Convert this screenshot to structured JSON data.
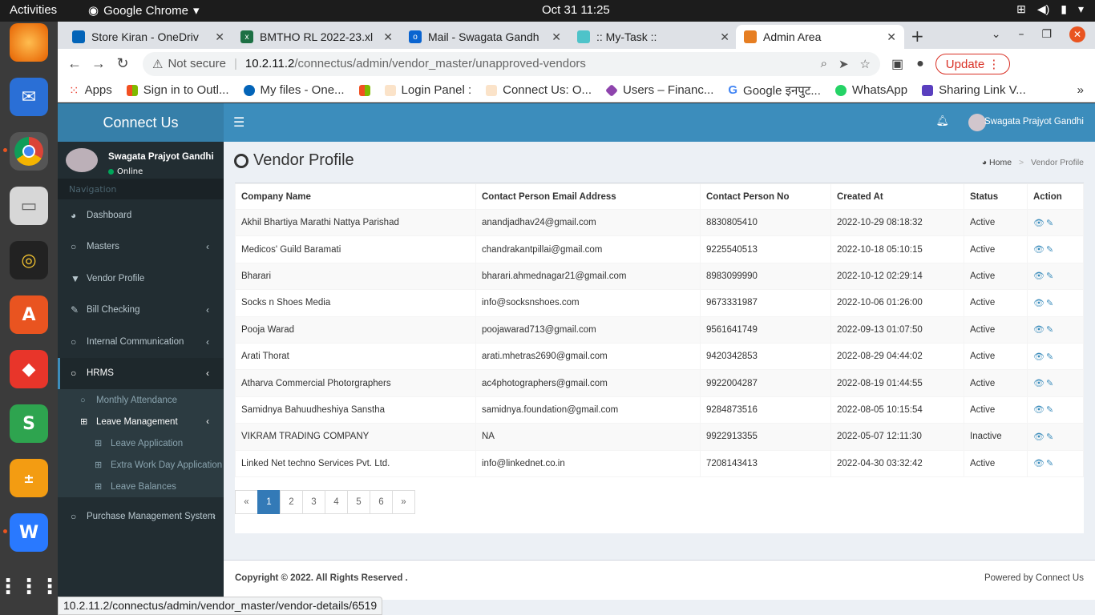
{
  "topbar": {
    "activities": "Activities",
    "app_name": "Google Chrome",
    "clock": "Oct 31  11:25"
  },
  "tabs": [
    {
      "title": "Store Kiran - OneDriv",
      "color": "#0364b8"
    },
    {
      "title": "BMTHO RL 2022-23.xl",
      "color": "#1d7044"
    },
    {
      "title": "Mail - Swagata Gandh",
      "color": "#0a64d0"
    },
    {
      "title": ":: My-Task ::",
      "color": "#4ec3c9"
    },
    {
      "title": "Admin Area",
      "color": "#e67e22"
    }
  ],
  "omnibox": {
    "security": "Not secure",
    "host": "10.2.11.2",
    "path": "/connectus/admin/vendor_master/unapproved-vendors"
  },
  "update_label": "Update",
  "bookmarks": [
    {
      "label": "Apps",
      "color": "#ea4335"
    },
    {
      "label": "Sign in to Outl...",
      "color": "#f25022"
    },
    {
      "label": "My files - One...",
      "color": "#0364b8"
    },
    {
      "label": "",
      "color": "#7fba00"
    },
    {
      "label": "Login Panel :",
      "color": "#e67e22"
    },
    {
      "label": "Connect Us: O...",
      "color": "#e67e22"
    },
    {
      "label": "Users – Financ...",
      "color": "#8e44ad"
    },
    {
      "label": "Google इनपुट...",
      "color": "#4285f4"
    },
    {
      "label": "WhatsApp",
      "color": "#25d366"
    },
    {
      "label": "Sharing Link V...",
      "color": "#5a3fbf"
    }
  ],
  "sidebar": {
    "logo": "Connect Us",
    "user_name": "Swagata Prajyot Gandhi",
    "user_status": "Online",
    "nav_header": "Navigation",
    "items": [
      {
        "label": "Dashboard",
        "icon": "dashboard-icon",
        "glyph": "◕"
      },
      {
        "label": "Masters",
        "icon": "circle-icon",
        "glyph": "○",
        "chev": "‹"
      },
      {
        "label": "Vendor Profile",
        "icon": "filter-icon",
        "glyph": "▼"
      },
      {
        "label": "Bill Checking",
        "icon": "pencil-icon",
        "glyph": "✎",
        "chev": "‹"
      },
      {
        "label": "Internal Communication",
        "icon": "circle-icon",
        "glyph": "○",
        "chev": "‹"
      },
      {
        "label": "HRMS",
        "icon": "circle-icon",
        "glyph": "○",
        "chev": "‹"
      }
    ],
    "hrms_sub": {
      "monthly": "Monthly Attendance",
      "leave_mgmt": "Leave Management",
      "leave_items": [
        "Leave Application",
        "Extra Work Day Application",
        "Leave Balances"
      ]
    },
    "purchase": "Purchase Management System"
  },
  "header": {
    "user_name": "Swagata Prajyot Gandhi"
  },
  "content": {
    "title": "Vendor Profile",
    "crumb_home": "Home",
    "crumb_current": "Vendor Profile"
  },
  "table": {
    "columns": [
      "Company Name",
      "Contact Person Email Address",
      "Contact Person No",
      "Created At",
      "Status",
      "Action"
    ],
    "rows": [
      [
        "Akhil Bhartiya Marathi Nattya Parishad",
        "anandjadhav24@gmail.com",
        "8830805410",
        "2022-10-29 08:18:32",
        "Active"
      ],
      [
        "Medicos' Guild Baramati",
        "chandrakantpillai@gmail.com",
        "9225540513",
        "2022-10-18 05:10:15",
        "Active"
      ],
      [
        "Bharari",
        "bharari.ahmednagar21@gmail.com",
        "8983099990",
        "2022-10-12 02:29:14",
        "Active"
      ],
      [
        "Socks n Shoes Media",
        "info@socksnshoes.com",
        "9673331987",
        "2022-10-06 01:26:00",
        "Active"
      ],
      [
        "Pooja Warad",
        "poojawarad713@gmail.com",
        "9561641749",
        "2022-09-13 01:07:50",
        "Active"
      ],
      [
        "Arati Thorat",
        "arati.mhetras2690@gmail.com",
        "9420342853",
        "2022-08-29 04:44:02",
        "Active"
      ],
      [
        "Atharva Commercial Photorgraphers",
        "ac4photographers@gmail.com",
        "9922004287",
        "2022-08-19 01:44:55",
        "Active"
      ],
      [
        "Samidnya Bahuudheshiya Sanstha",
        "samidnya.foundation@gmail.com",
        "9284873516",
        "2022-08-05 10:15:54",
        "Active"
      ],
      [
        "VIKRAM TRADING COMPANY",
        "NA",
        "9922913355",
        "2022-05-07 12:11:30",
        "Inactive"
      ],
      [
        "Linked Net techno Services Pvt. Ltd.",
        "info@linkednet.co.in",
        "7208143413",
        "2022-04-30 03:32:42",
        "Active"
      ]
    ]
  },
  "pagination": [
    "«",
    "1",
    "2",
    "3",
    "4",
    "5",
    "6",
    "»"
  ],
  "pagination_current": "1",
  "footer": {
    "copyright": "Copyright © 2022. All Rights Reserved .",
    "powered": "Powered by Connect Us"
  },
  "status_url": "10.2.11.2/connectus/admin/vendor_master/vendor-details/6519"
}
